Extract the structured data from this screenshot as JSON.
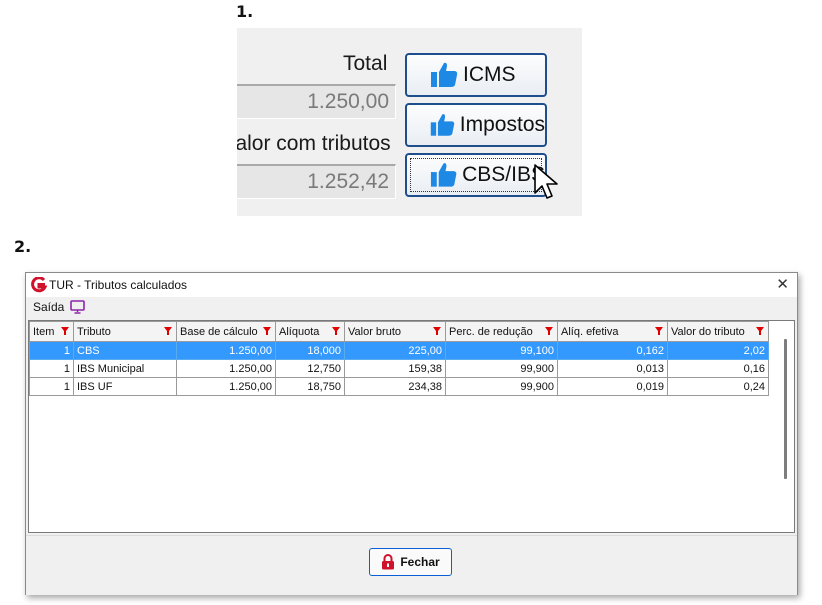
{
  "steps": {
    "one": "1.",
    "two": "2."
  },
  "panel1": {
    "total_label": "Total",
    "total_value": "1.250,00",
    "valor_label": "Valor com tributos",
    "valor_value": "1.252,42",
    "btn_icms": "ICMS",
    "btn_impostos": "Impostos",
    "btn_cbsibs": "CBS/IBS",
    "accent": "#1f4e8c",
    "thumb_color": "#1e88e5",
    "icon": "thumbs-up-icon"
  },
  "window": {
    "title": "TUR - Tributos calculados",
    "menu_saida": "Saída",
    "menu_icon": "monitor-icon",
    "close_glyph": "✕",
    "columns": [
      "Item",
      "Tributo",
      "Base de cálculo",
      "Alíquota",
      "Valor bruto",
      "Perc. de redução",
      "Alíq. efetiva",
      "Valor do tributo"
    ],
    "rows": [
      [
        "1",
        "CBS",
        "1.250,00",
        "18,000",
        "225,00",
        "99,100",
        "0,162",
        "2,02"
      ],
      [
        "1",
        "IBS Municipal",
        "1.250,00",
        "12,750",
        "159,38",
        "99,900",
        "0,013",
        "0,16"
      ],
      [
        "1",
        "IBS UF",
        "1.250,00",
        "18,750",
        "234,38",
        "99,900",
        "0,019",
        "0,24"
      ]
    ],
    "selected_row": 0,
    "selection_color": "#3399ff",
    "filter_color": "#e00000",
    "fechar_label": "Fechar",
    "fechar_icon": "lock-icon"
  }
}
